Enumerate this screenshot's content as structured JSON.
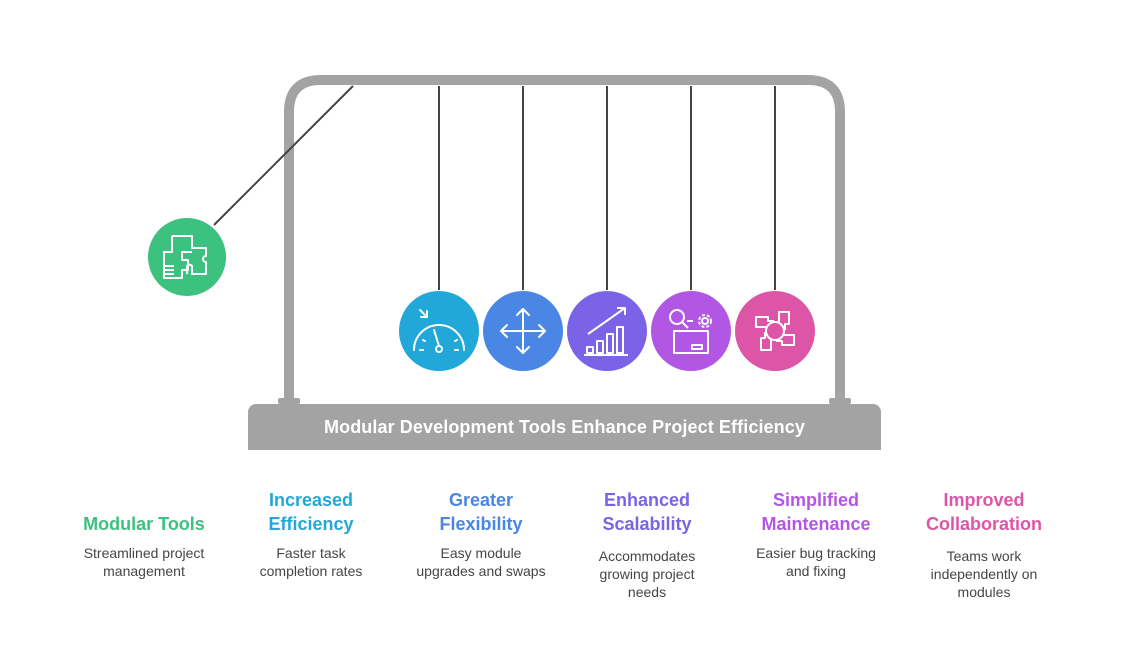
{
  "title": "Modular Development Tools Enhance Project Efficiency",
  "frame_color": "#a3a3a3",
  "string_color": "#444444",
  "balls": [
    {
      "id": "modular-tools",
      "icon": "puzzle-icon",
      "color": "#3cc17f",
      "swung": true
    },
    {
      "id": "increased-efficiency",
      "icon": "speedometer-icon",
      "color": "#21a8d8",
      "swung": false
    },
    {
      "id": "greater-flexibility",
      "icon": "move-arrows-icon",
      "color": "#4a86e4",
      "swung": false
    },
    {
      "id": "enhanced-scalability",
      "icon": "growth-chart-icon",
      "color": "#7a63e6",
      "swung": false
    },
    {
      "id": "simplified-maintenance",
      "icon": "search-gear-box-icon",
      "color": "#b257e3",
      "swung": false
    },
    {
      "id": "improved-collaboration",
      "icon": "hands-together-icon",
      "color": "#dd55a6",
      "swung": false
    }
  ],
  "items": [
    {
      "title_lines": [
        "",
        "Modular Tools"
      ],
      "desc_lines": [
        "Streamlined project",
        "management"
      ],
      "color": "#3cc17f"
    },
    {
      "title_lines": [
        "Increased",
        "Efficiency"
      ],
      "desc_lines": [
        "Faster task",
        "completion rates"
      ],
      "color": "#21a8d8"
    },
    {
      "title_lines": [
        "Greater",
        "Flexibility"
      ],
      "desc_lines": [
        "Easy module",
        "upgrades and swaps"
      ],
      "color": "#4a86e4"
    },
    {
      "title_lines": [
        "Enhanced",
        "Scalability"
      ],
      "desc_lines": [
        "Accommodates",
        "growing project",
        "needs"
      ],
      "color": "#7a63e6"
    },
    {
      "title_lines": [
        "Simplified",
        "Maintenance"
      ],
      "desc_lines": [
        "Easier bug tracking",
        "and fixing"
      ],
      "color": "#b257e3"
    },
    {
      "title_lines": [
        "Improved",
        "Collaboration"
      ],
      "desc_lines": [
        "Teams work",
        "independently on",
        "modules"
      ],
      "color": "#dd55a6"
    }
  ]
}
